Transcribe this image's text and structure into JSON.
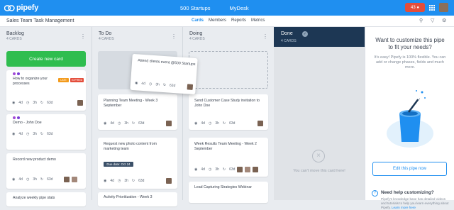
{
  "app": {
    "logo_text": "pipefy",
    "brand_color": "#1f8ff0"
  },
  "topnav": {
    "items": [
      "500 Startups",
      "MyDesk"
    ],
    "notifications": "43"
  },
  "pipe": {
    "name": "Sales Team Task Management"
  },
  "tabs": [
    "Cards",
    "Members",
    "Reports",
    "Metrics"
  ],
  "columns": [
    {
      "title": "Backlog",
      "count": "4 CARDS"
    },
    {
      "title": "To Do",
      "count": "4 CARDS"
    },
    {
      "title": "Doing",
      "count": "4 CARDS"
    },
    {
      "title": "Done",
      "count": "4 CARDS"
    }
  ],
  "create_card_label": "Create new card",
  "cards": {
    "backlog": [
      {
        "title": "How to organize your processes",
        "meta": [
          "4d",
          "3h",
          "63d"
        ],
        "labels": [
          "LATE",
          "EXPIRED"
        ]
      },
      {
        "title": "Demo - John Doe",
        "meta": [
          "4d",
          "3h",
          "63d"
        ]
      },
      {
        "title": "Record new product demo",
        "meta": [
          "4d",
          "3h",
          "63d"
        ]
      },
      {
        "title": "Analyze weekly pipe stats"
      }
    ],
    "drag": {
      "title": "Attend clients event @500 Startups",
      "meta": [
        "4d",
        "3h",
        "63d"
      ]
    },
    "todo": [
      {
        "title": "Planning Team Meeting - Week 3 September",
        "meta": [
          "4d",
          "3h",
          "63d"
        ]
      },
      {
        "title": "Request new photo content from marketing team",
        "due": "Due date: Oct 24",
        "meta": [
          "4d",
          "3h",
          "63d"
        ]
      },
      {
        "title": "Activity Prioritization - Week 3"
      }
    ],
    "doing": [
      {
        "title": "Send Customer Case Study invitation to John Doe",
        "meta": [
          "4d",
          "3h",
          "63d"
        ]
      },
      {
        "title": "Week Results Team Meeting - Week 2 September",
        "meta": [
          "4d",
          "3h",
          "63d"
        ]
      },
      {
        "title": "Lead Capturing Strategies Webinar"
      }
    ]
  },
  "done_message": "You can't move this card here!",
  "side": {
    "title": "Want to customize this pipe to fit your needs?",
    "text": "It's easy! Pipefy is 100% flexible. You can add or change phases, fields and much more.",
    "button": "Edit this pipe now",
    "help_title": "Need help customizing?",
    "help_text": "Pipefy's knowledge base has detailed videos and tutorials to help you learn everything about Pipefy.",
    "learn_more": "Learn more here"
  },
  "colors": {
    "create_btn": "#2fbd4f",
    "late": "#f39b1c",
    "expired": "#e44d3a",
    "done_header": "#1d3754"
  }
}
